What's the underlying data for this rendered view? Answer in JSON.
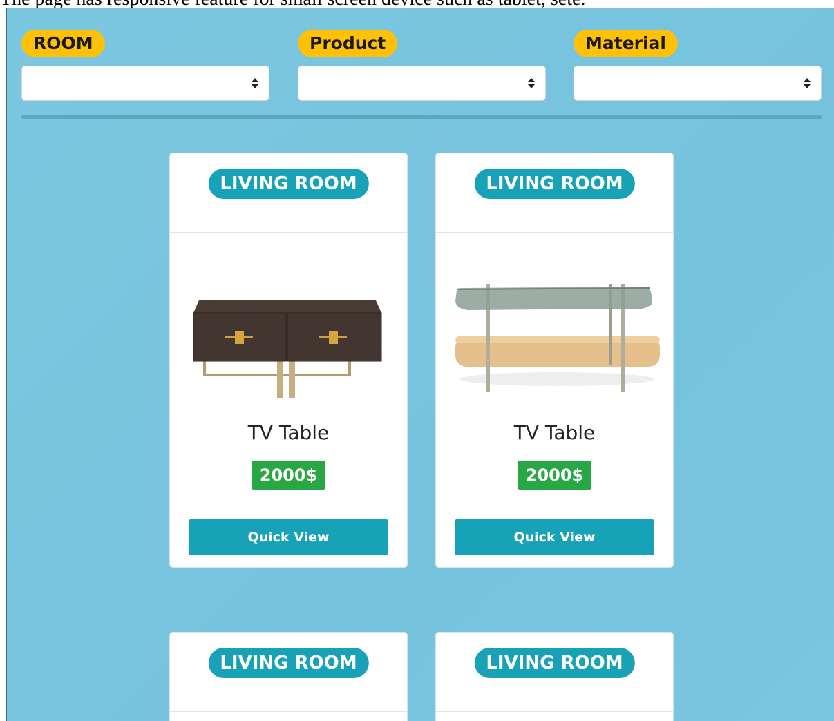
{
  "caption": "The page has responsive feature for small screen device such as tablet, sete.",
  "filters": [
    {
      "label": "ROOM",
      "value": ""
    },
    {
      "label": "Product",
      "value": ""
    },
    {
      "label": "Material",
      "value": ""
    }
  ],
  "cards": [
    {
      "room": "LIVING ROOM",
      "title": "TV Table",
      "price": "2000$",
      "button": "Quick View"
    },
    {
      "room": "LIVING ROOM",
      "title": "TV Table",
      "price": "2000$",
      "button": "Quick View"
    },
    {
      "room": "LIVING ROOM",
      "title": "",
      "price": "",
      "button": ""
    },
    {
      "room": "LIVING ROOM",
      "title": "",
      "price": "",
      "button": ""
    }
  ],
  "colors": {
    "background": "#79c4de",
    "filter_label": "#ffc107",
    "room_badge": "#17a2b8",
    "price_badge": "#28a745",
    "button": "#17a2b8"
  }
}
